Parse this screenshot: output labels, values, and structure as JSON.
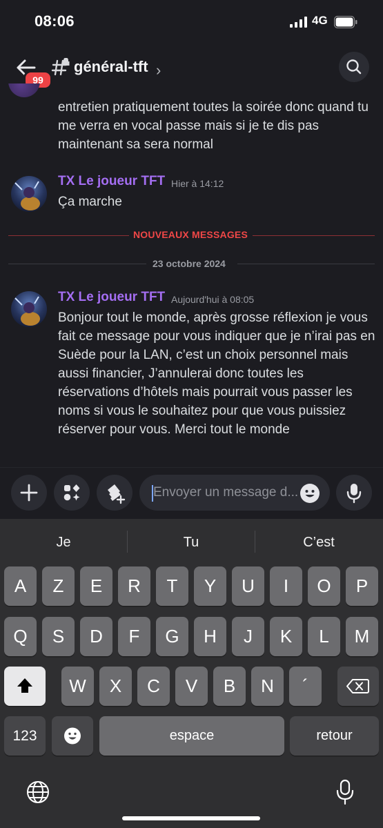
{
  "status_bar": {
    "time": "08:06",
    "network": "4G"
  },
  "header": {
    "unread_badge": "99",
    "channel_name": "général-tft",
    "chevron": "›"
  },
  "messages": {
    "previous_text": "entretien pratiquement toutes la soirée donc quand tu me verra en vocal passe mais si je te dis pas maintenant sa sera normal",
    "items": [
      {
        "author": "TX Le joueur TFT",
        "timestamp": "Hier à 14:12",
        "text": "Ça marche"
      },
      {
        "author": "TX Le joueur TFT",
        "timestamp": "Aujourd'hui à 08:05",
        "text": "Bonjour tout le monde, après grosse réflexion je vous fait ce message pour vous indiquer que je n’irai pas en Suède pour la LAN, c’est un choix personnel mais aussi financier, J’annulerai donc toutes les réservations d’hôtels mais pourrait vous passer les noms si vous le souhaitez pour que vous puissiez réserver pour vous. Merci tout le monde"
      }
    ],
    "new_messages_label": "NOUVEAUX MESSAGES",
    "date_divider": "23 octobre 2024"
  },
  "composer": {
    "placeholder": "Envoyer un message d..."
  },
  "keyboard": {
    "suggestions": [
      "Je",
      "Tu",
      "C’est"
    ],
    "row1": [
      "A",
      "Z",
      "E",
      "R",
      "T",
      "Y",
      "U",
      "I",
      "O",
      "P"
    ],
    "row2": [
      "Q",
      "S",
      "D",
      "F",
      "G",
      "H",
      "J",
      "K",
      "L",
      "M"
    ],
    "row3": [
      "W",
      "X",
      "C",
      "V",
      "B",
      "N",
      "´"
    ],
    "numbers_label": "123",
    "space_label": "espace",
    "return_label": "retour"
  },
  "colors": {
    "background": "#1c1c21",
    "author": "#a46ef2",
    "new_messages": "#f04747",
    "badge": "#ed4245"
  },
  "icons": [
    "back-arrow-icon",
    "hash-icon",
    "search-icon",
    "plus-icon",
    "apps-icon",
    "gift-icon",
    "emoji-icon",
    "mic-icon",
    "shift-icon",
    "backspace-icon",
    "emoji-keyboard-icon",
    "globe-icon",
    "dictation-icon"
  ]
}
